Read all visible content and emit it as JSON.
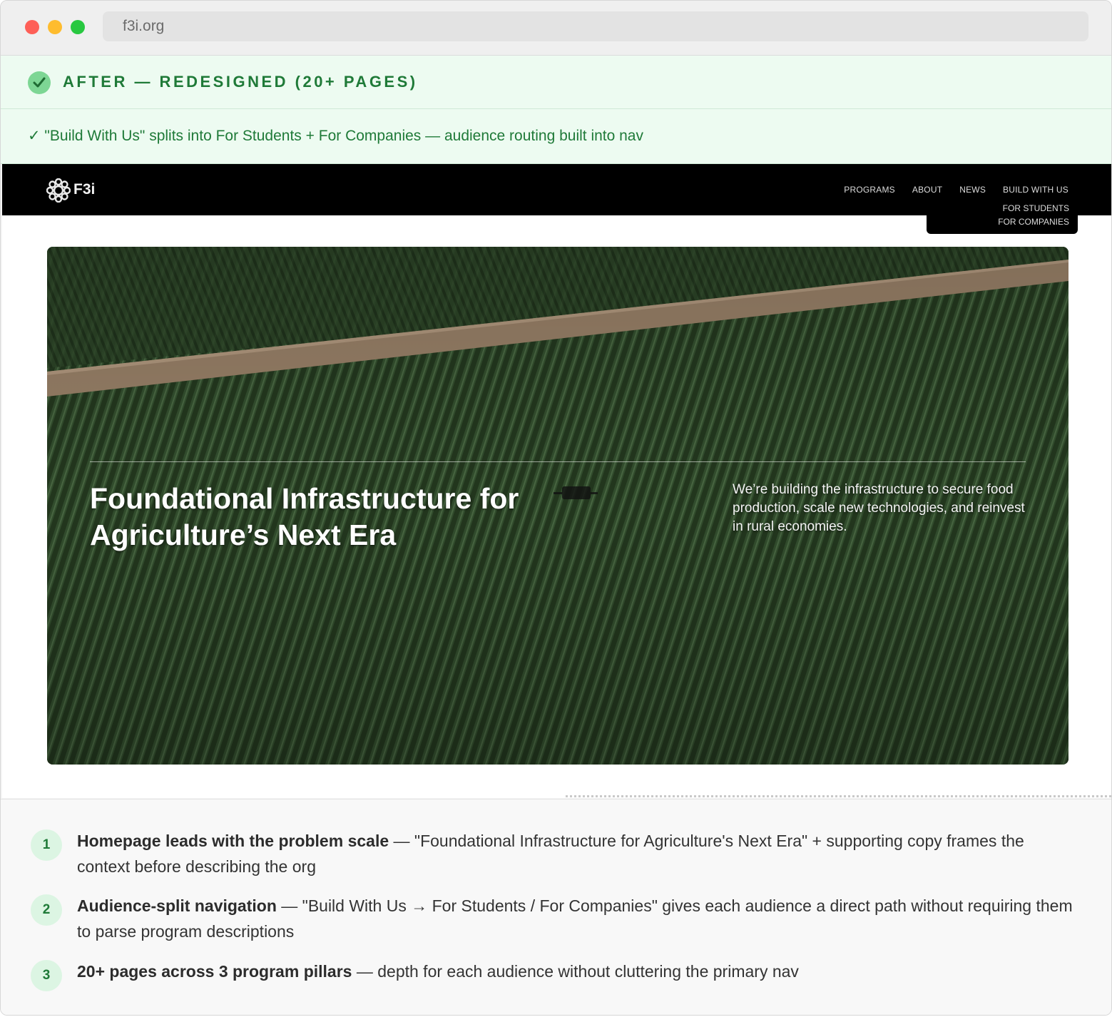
{
  "browser": {
    "url": "f3i.org"
  },
  "banner": {
    "title": "AFTER — REDESIGNED (20+ PAGES)",
    "note": "✓ \"Build With Us\" splits into For Students + For Companies — audience routing built into nav",
    "accent": "#1f7a38"
  },
  "site": {
    "logo_text": "F3i",
    "nav": [
      "PROGRAMS",
      "ABOUT",
      "NEWS",
      "BUILD WITH US"
    ],
    "dropdown": [
      "FOR STUDENTS",
      "FOR COMPANIES"
    ],
    "hero_title": "Foundational Infrastructure for Agriculture’s Next Era",
    "hero_sub": "We’re building the infrastructure to secure food production, scale new technologies, and reinvest in rural economies."
  },
  "notes": [
    {
      "num": "1",
      "bold": "Homepage leads with the problem scale",
      "text": " — \"Foundational Infrastructure for Agriculture's Next Era\" + supporting copy frames the context before describing the org"
    },
    {
      "num": "2",
      "bold": "Audience-split navigation",
      "text": " — \"Build With Us → For Students / For Companies\" gives each audience a direct path without requiring them to parse program descriptions"
    },
    {
      "num": "3",
      "bold": "20+ pages across 3 program pillars",
      "text": " — depth for each audience without cluttering the primary nav"
    }
  ]
}
